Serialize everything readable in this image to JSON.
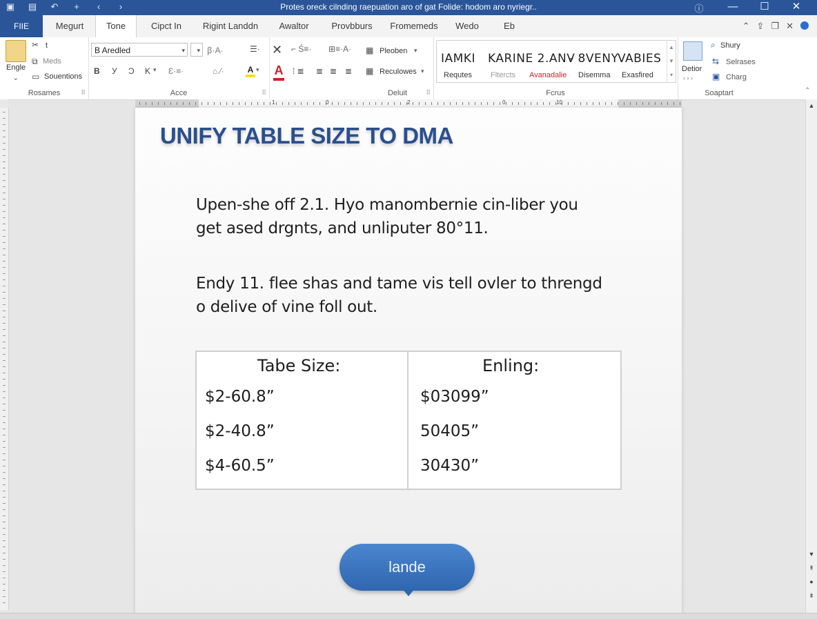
{
  "window": {
    "title": "Protes oreck cilnding raepuation aro of gat Folide: hodom aro nyriegr.."
  },
  "tabs": {
    "file": "FIIE",
    "items": [
      "Megurt",
      "Tone",
      "Cipct In",
      "Rigint Landdn",
      "Awaltor",
      "Provbburs",
      "Fromemeds",
      "Wedo",
      "Eb"
    ]
  },
  "ribbon": {
    "clipboard": {
      "paste_label": "Engle",
      "item1": "t",
      "item2": "Meds",
      "item3": "Souentions",
      "group_label": "Rosames"
    },
    "font": {
      "font_name": "B Aredled",
      "bold": "B",
      "italic": "У",
      "underline": "Ɔ",
      "k": "K",
      "group_label": "Acce"
    },
    "paragraph": {
      "item1": "Pleoben",
      "item2": "Reculowes",
      "group_label": "Deluit"
    },
    "styles": {
      "names": [
        "IAMKI",
        "KARINE 2.ANV",
        "- 8VENY",
        "VABIES"
      ],
      "subs": [
        "Requtes",
        "Fltercts",
        "Avanadalie",
        "Disemma",
        "Exasfired"
      ],
      "group_label": "Fcrus"
    },
    "editing": {
      "big_label": "Detior",
      "item1": "Shury",
      "item2": "Selrases",
      "item3": "Charg",
      "group_label": "Soaptart"
    }
  },
  "ruler": {
    "marks": [
      "1",
      "0",
      "2",
      "0",
      "10"
    ]
  },
  "document": {
    "title": "UNIFY TABLE SIZE TO DMA",
    "para1_line1": "Upen-she off 2.1. Hyo manombernie cin-liber you",
    "para1_line2": "get ased drgnts, and unliputer 80°11.",
    "para2_line1": "Endy 11. flee shas and tame vis tell ovler to threngd",
    "para2_line2": "o delive of vine foll out.",
    "table": {
      "headers": [
        "Tabe Size:",
        "Enling:"
      ],
      "rows": [
        [
          "$2-60.8”",
          "$03099”"
        ],
        [
          "$2-40.8”",
          "50405”"
        ],
        [
          "$4-60.5”",
          "30430”"
        ]
      ]
    },
    "button_label": "lande"
  }
}
